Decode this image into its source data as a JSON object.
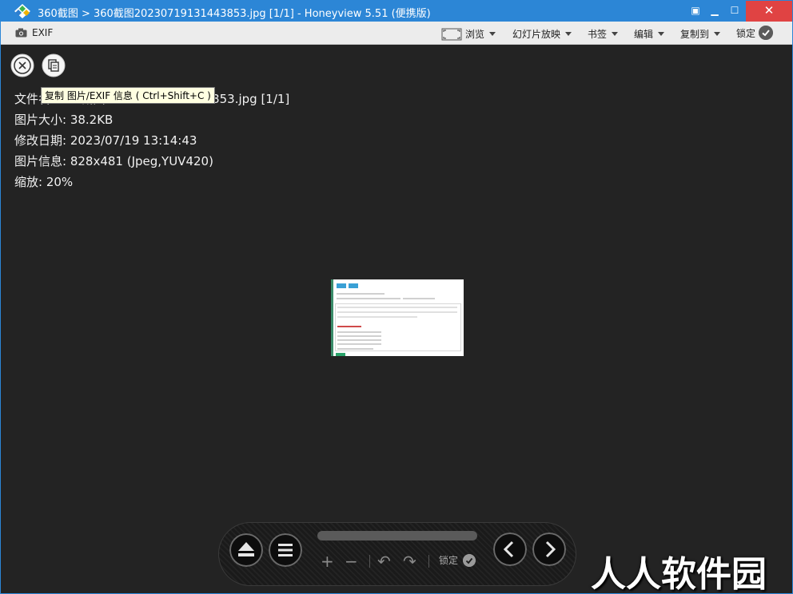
{
  "titlebar": {
    "title": "360截图 > 360截图20230719131443853.jpg [1/1] - Honeyview 5.51 (便携版)",
    "opt_symbol": "▣",
    "min_symbol": "▁",
    "max_symbol": "☐",
    "close_symbol": "✕",
    "accent": "#2c86d6",
    "close_color": "#e04343"
  },
  "menubar": {
    "exif_label": "EXIF",
    "browse_label": "浏览",
    "slideshow_label": "幻灯片放映",
    "bookmark_label": "书签",
    "edit_label": "编辑",
    "copyto_label": "复制到",
    "lock_label": "锁定"
  },
  "tooltip": {
    "text": "复制 图片/EXIF 信息 ( Ctrl+Shift+C )"
  },
  "info": {
    "filename_line": "文件名: 360截图20230719131443853.jpg [1/1]",
    "size_line": "图片大小: 38.2KB",
    "date_line": "修改日期: 2023/07/19 13:14:43",
    "image_info_line": "图片信息: 828x481 (Jpeg,YUV420)",
    "zoom_line": "缩放: 20%"
  },
  "controls": {
    "zoom_in_symbol": "+",
    "zoom_out_symbol": "−",
    "rotate_left_symbol": "↶",
    "rotate_right_symbol": "↷",
    "lock_label": "锁定"
  },
  "watermark": {
    "text": "人人软件园"
  },
  "icons": {
    "app": "honeyview-logo-icon",
    "camera": "camera-icon",
    "close": "close-circle-icon",
    "copy": "copy-icon",
    "eject": "eject-icon",
    "list": "list-icon",
    "prev": "chevron-left-icon",
    "next": "chevron-right-icon"
  }
}
